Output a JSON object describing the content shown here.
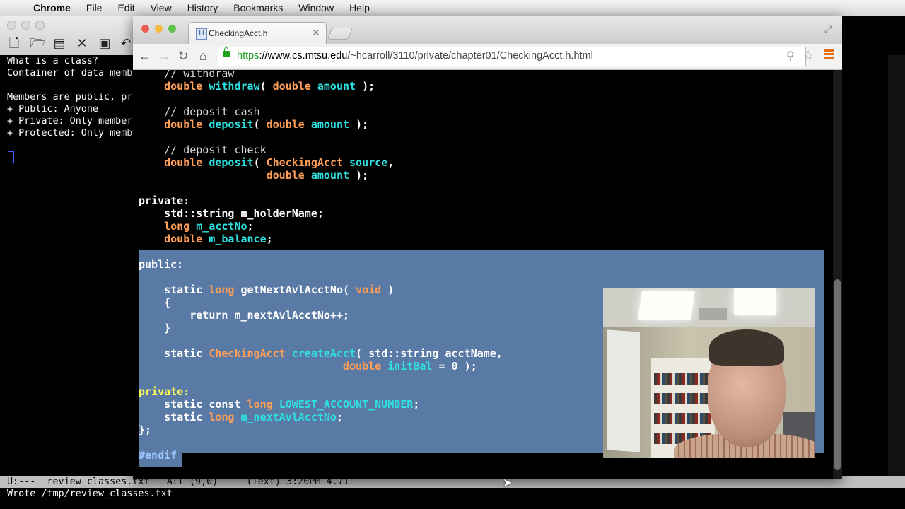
{
  "menubar": {
    "apple_icon": "",
    "app_name": "Chrome",
    "items": [
      "File",
      "Edit",
      "View",
      "History",
      "Bookmarks",
      "Window",
      "Help"
    ]
  },
  "emacs": {
    "text_lines": [
      "What is a class?",
      "Container of data memb",
      "",
      "Members are public, pr",
      "+ Public: Anyone",
      "+ Private: Only member",
      "+ Protected: Only memb"
    ],
    "modeline": "U:---  review_classes.txt   All (9,0)     (Text) 3:20PM 4.71",
    "minibuffer": "Wrote /tmp/review_classes.txt"
  },
  "browser": {
    "tab_title": "CheckingAcct.h",
    "tab_favicon": "H",
    "url_scheme": "https",
    "url_host": "://www.cs.mtsu.edu",
    "url_path": "/~hcarroll/3110/private/chapter01/CheckingAcct.h.html",
    "icons": {
      "back": "back-arrow-icon",
      "forward": "forward-arrow-icon",
      "reload": "reload-icon",
      "home": "home-icon",
      "zoom": "zoom-icon",
      "star": "bookmark-star-icon",
      "menu": "chrome-menu-icon"
    }
  },
  "code": {
    "l_withdraw_comment": "    // withdraw",
    "l_withdraw_a": "    ",
    "l_withdraw_kw1": "double",
    "l_withdraw_fn": "withdraw",
    "l_withdraw_b": "( ",
    "l_withdraw_kw2": "double",
    "l_withdraw_arg": "amount",
    "l_withdraw_c": " );",
    "l_dep_comment": "    // deposit cash",
    "l_dep_fn": "deposit",
    "l_depchk_comment": "    // deposit check",
    "l_depchk_type": "CheckingAcct",
    "l_depchk_arg": "source",
    "private1": "private:",
    "std_string": "std::string m_holderName;",
    "long_kw": "long",
    "acctno": "m_acctNo",
    "balance": "m_balance",
    "public": "public:",
    "static": "static",
    "getnext_fn": "getNextAvlAcctNo",
    "void_kw": "void",
    "open_brace": "{",
    "return_stmt": "return m_nextAvlAcctNo++;",
    "close_brace": "}",
    "create_fn": "createAcct",
    "std_string_param": "std::string acctName,",
    "initbal": "initBal",
    "initbal_rest": " = 0 );",
    "private2": "private:",
    "const_txt": "static const",
    "lowest": "LOWEST_ACCOUNT_NUMBER",
    "nextavl": "m_nextAvlAcctNo",
    "end_class": "};",
    "endif": "#endif"
  },
  "colors": {
    "keyword": "#ff9e57",
    "function": "#2ee0e0",
    "selection": "#5a7aa6",
    "private_label": "#ffff55"
  }
}
